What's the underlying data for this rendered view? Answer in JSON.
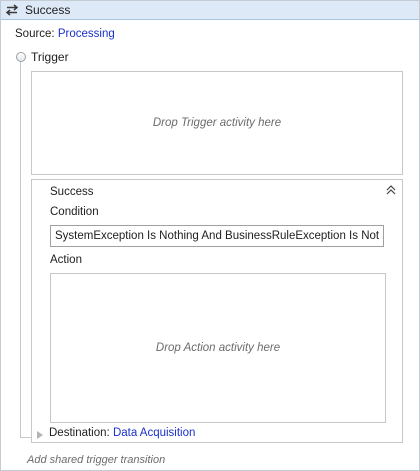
{
  "header": {
    "title": "Success",
    "icon": "transition-icon"
  },
  "source": {
    "label": "Source:",
    "value": "Processing"
  },
  "trigger": {
    "label": "Trigger",
    "drop_hint": "Drop Trigger activity here"
  },
  "transition": {
    "title": "Success",
    "condition_label": "Condition",
    "condition_value": "SystemException Is Nothing And BusinessRuleException Is Nothing",
    "action_label": "Action",
    "action_drop_hint": "Drop Action activity here"
  },
  "destination": {
    "label": "Destination:",
    "value": "Data Acquisition"
  },
  "footer": {
    "add_shared_label": "Add shared trigger transition"
  },
  "colors": {
    "header_bg": "#dde9f6",
    "link": "#1b31c9",
    "hint_text": "#6b6b6b"
  }
}
